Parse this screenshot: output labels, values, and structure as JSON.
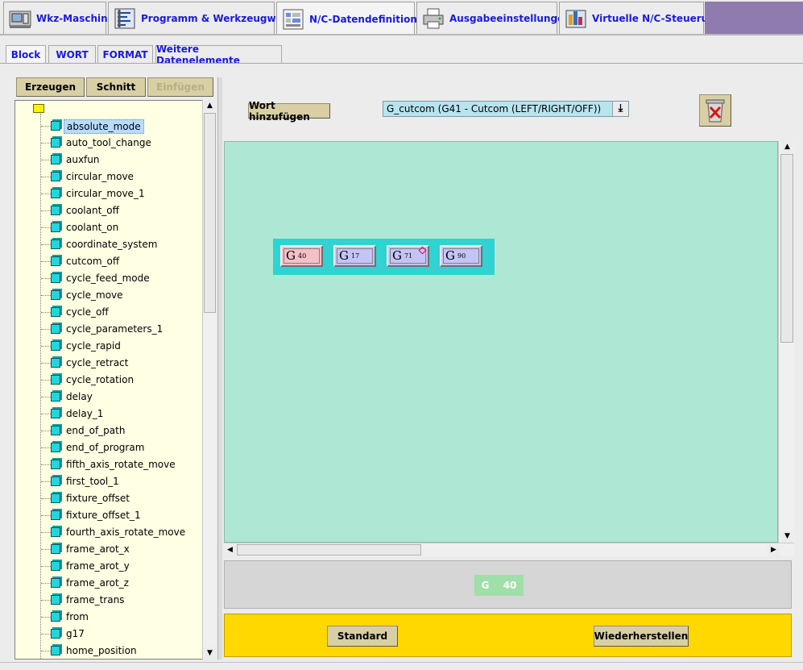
{
  "top_tabs": [
    {
      "label": "Wkz-Maschine",
      "icon": "machine-tool-icon"
    },
    {
      "label": "Programm & Werkzeugweg",
      "icon": "program-toolpath-icon"
    },
    {
      "label": "N/C-Datendefinitionen",
      "icon": "nc-data-definitions-icon",
      "active": true
    },
    {
      "label": "Ausgabeeinstellungen",
      "icon": "printer-icon"
    },
    {
      "label": "Virtuelle N/C-Steuerung",
      "icon": "virtual-nc-controller-icon"
    }
  ],
  "sub_tabs": [
    {
      "label": "Block",
      "active": true
    },
    {
      "label": "WORT"
    },
    {
      "label": "FORMAT"
    },
    {
      "label": "Weitere Datenelemente"
    }
  ],
  "left_toolbar": {
    "create_label": "Erzeugen",
    "cut_label": "Schnitt",
    "paste_label": "Einfügen"
  },
  "tree": {
    "selected": "absolute_mode",
    "items": [
      "absolute_mode",
      "auto_tool_change",
      "auxfun",
      "circular_move",
      "circular_move_1",
      "coolant_off",
      "coolant_on",
      "coordinate_system",
      "cutcom_off",
      "cycle_feed_mode",
      "cycle_move",
      "cycle_off",
      "cycle_parameters_1",
      "cycle_rapid",
      "cycle_retract",
      "cycle_rotation",
      "delay",
      "delay_1",
      "end_of_path",
      "end_of_program",
      "fifth_axis_rotate_move",
      "first_tool_1",
      "fixture_offset",
      "fixture_offset_1",
      "fourth_axis_rotate_move",
      "frame_arot_x",
      "frame_arot_y",
      "frame_arot_z",
      "frame_trans",
      "from",
      "g17",
      "home_position"
    ]
  },
  "editor": {
    "add_word_label": "Wort hinzufügen",
    "word_select_value": "G_cutcom (G41 - Cutcom (LEFT/RIGHT/OFF))",
    "block_words": [
      {
        "letter": "G",
        "number": "40",
        "color": "#f6c0c8",
        "marker": false
      },
      {
        "letter": "G",
        "number": "17",
        "color": "#c4c4f6",
        "marker": false
      },
      {
        "letter": "G",
        "number": "71",
        "color": "#c4c4f6",
        "marker": true
      },
      {
        "letter": "G",
        "number": "90",
        "color": "#c4c4f6",
        "marker": false
      }
    ]
  },
  "preview": {
    "letter": "G",
    "number": "40"
  },
  "footer": {
    "standard_label": "Standard",
    "restore_label": "Wiederherstellen"
  },
  "colors": {
    "tab_text": "#1a1adc",
    "canvas_bg": "#aee8d4",
    "block_bg": "#30d2d2",
    "footer_bg": "#ffd800",
    "tree_bg": "#ffffe3"
  }
}
